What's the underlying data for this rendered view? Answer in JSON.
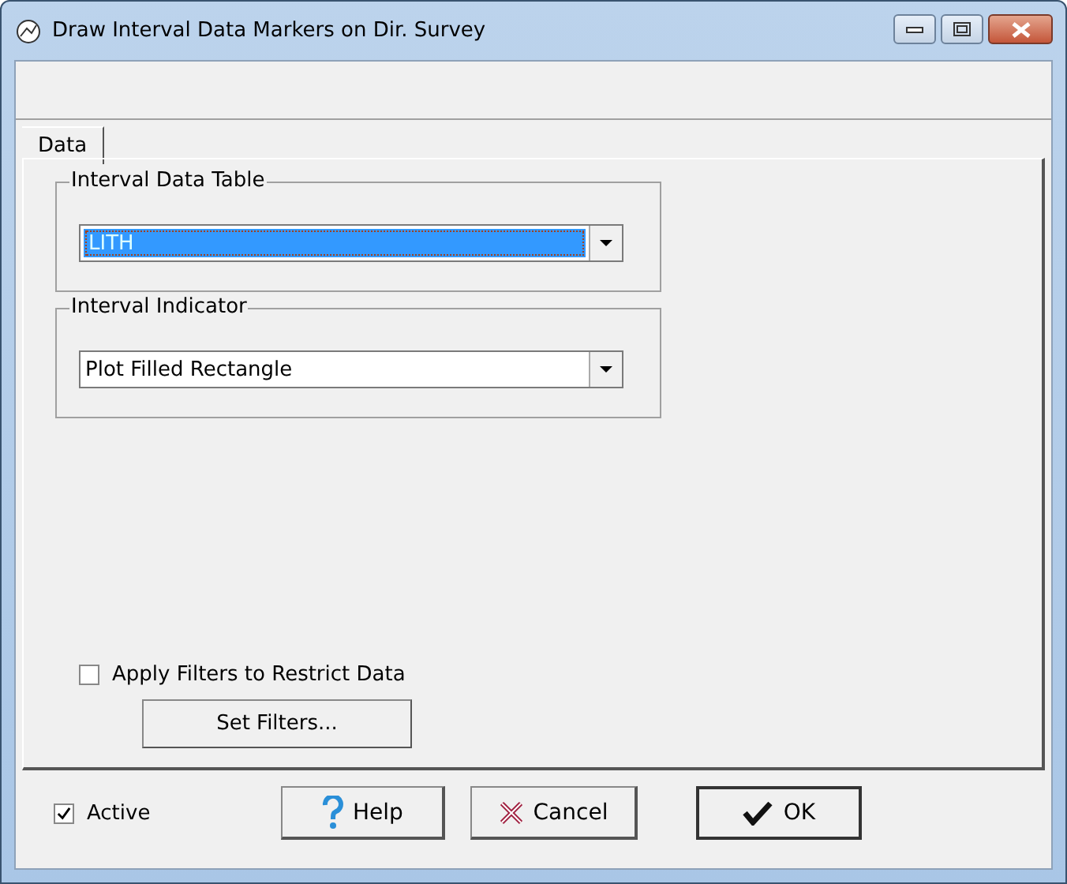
{
  "window": {
    "title": "Draw Interval Data Markers on Dir. Survey"
  },
  "tabs": [
    {
      "label": "Data",
      "selected": true
    }
  ],
  "groups": [
    {
      "title": "Interval Data Table",
      "value": "LITH",
      "focused": true
    },
    {
      "title": "Interval Indicator",
      "value": "Plot Filled Rectangle",
      "focused": false
    }
  ],
  "filter": {
    "label": "Apply Filters to Restrict Data",
    "checked": false,
    "button": "Set Filters..."
  },
  "active": {
    "label": "Active",
    "checked": true
  },
  "buttons": [
    {
      "kind": "help",
      "label": "Help"
    },
    {
      "kind": "cancel",
      "label": "Cancel"
    },
    {
      "kind": "ok",
      "label": "OK",
      "default": true
    }
  ]
}
